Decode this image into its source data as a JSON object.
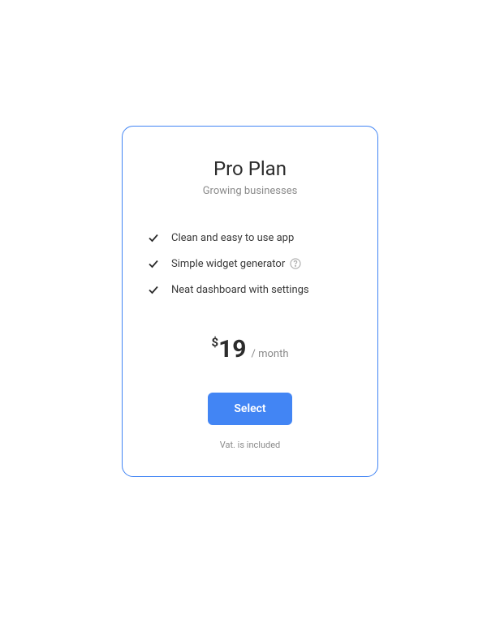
{
  "plan": {
    "title": "Pro Plan",
    "subtitle": "Growing businesses",
    "features": [
      {
        "label": "Clean and easy to use app",
        "has_help": false
      },
      {
        "label": "Simple widget generator",
        "has_help": true
      },
      {
        "label": "Neat dashboard with settings",
        "has_help": false
      }
    ],
    "price": {
      "currency": "$",
      "amount": "19",
      "period": "/ month"
    },
    "cta_label": "Select",
    "vat_note": "Vat. is included"
  },
  "colors": {
    "accent": "#4285f4",
    "text_primary": "#2c2c2c",
    "text_secondary": "#8a8a8a"
  }
}
